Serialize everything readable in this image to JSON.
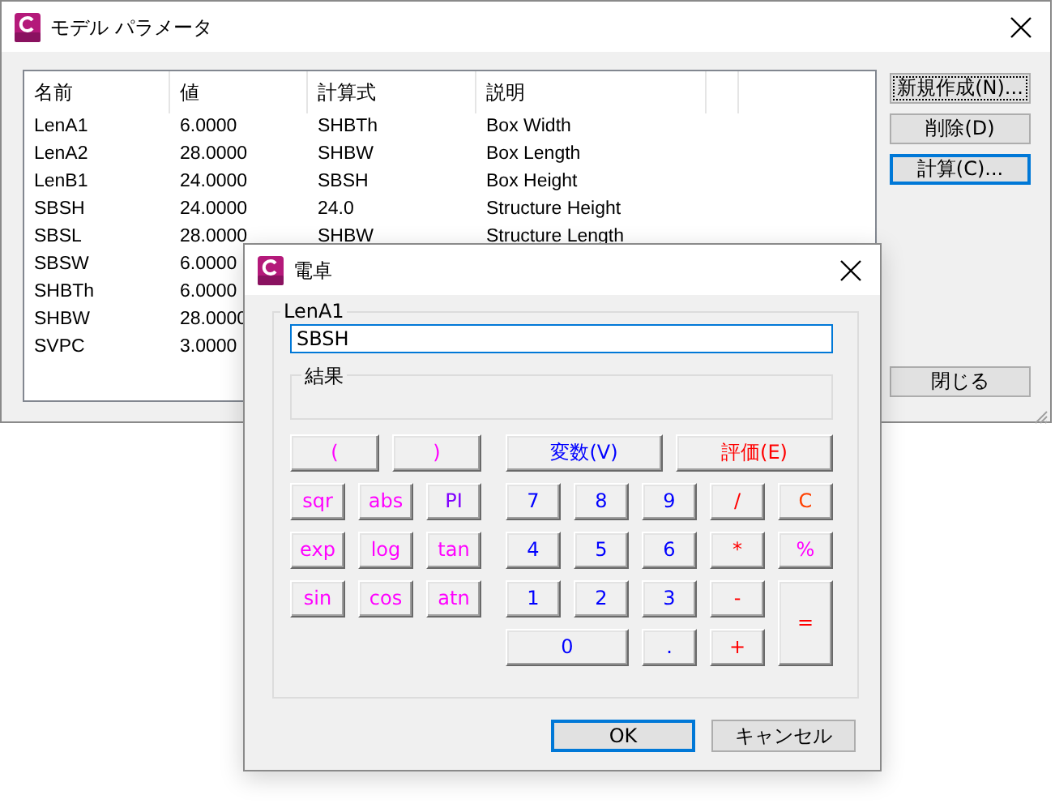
{
  "main_window": {
    "title": "モデル パラメータ",
    "table": {
      "columns": [
        "名前",
        "値",
        "計算式",
        "説明"
      ],
      "rows": [
        {
          "name": "LenA1",
          "value": "6.0000",
          "formula": "SHBTh",
          "description": "Box Width"
        },
        {
          "name": "LenA2",
          "value": "28.0000",
          "formula": "SHBW",
          "description": "Box Length"
        },
        {
          "name": "LenB1",
          "value": "24.0000",
          "formula": "SBSH",
          "description": "Box Height"
        },
        {
          "name": "SBSH",
          "value": "24.0000",
          "formula": "24.0",
          "description": "Structure Height"
        },
        {
          "name": "SBSL",
          "value": "28.0000",
          "formula": "SHBW",
          "description": "Structure Length"
        },
        {
          "name": "SBSW",
          "value": "6.0000"
        },
        {
          "name": "SHBTh",
          "value": "6.0000"
        },
        {
          "name": "SHBW",
          "value": "28.0000"
        },
        {
          "name": "SVPC",
          "value": "3.0000"
        }
      ]
    },
    "buttons": [
      {
        "label": "新規作成(N)...",
        "focused": true,
        "default": false
      },
      {
        "label": "削除(D)",
        "focused": false,
        "default": false
      },
      {
        "label": "計算(C)...",
        "focused": false,
        "default": true
      }
    ],
    "close_button": "閉じる"
  },
  "calculator": {
    "title": "電卓",
    "group_label": "LenA1",
    "expression": "SBSH",
    "result_label": "結果",
    "top_left_keys": [
      {
        "label": "(",
        "color": "#ff00ff"
      },
      {
        "label": ")",
        "color": "#ff00ff"
      }
    ],
    "top_right_keys": [
      {
        "label": "変数(V)",
        "color": "#0000ff"
      },
      {
        "label": "評価(E)",
        "color": "#ff0000"
      }
    ],
    "function_keys": [
      {
        "label": "sqr",
        "color": "#ff00ff"
      },
      {
        "label": "abs",
        "color": "#ff00ff"
      },
      {
        "label": "PI",
        "color": "#8000ff"
      },
      {
        "label": "exp",
        "color": "#ff00ff"
      },
      {
        "label": "log",
        "color": "#ff00ff"
      },
      {
        "label": "tan",
        "color": "#ff00ff"
      },
      {
        "label": "sin",
        "color": "#ff00ff"
      },
      {
        "label": "cos",
        "color": "#ff00ff"
      },
      {
        "label": "atn",
        "color": "#ff00ff"
      }
    ],
    "number_keys": [
      {
        "label": "7",
        "color": "#0000ff",
        "kind": "key"
      },
      {
        "label": "8",
        "color": "#0000ff",
        "kind": "key"
      },
      {
        "label": "9",
        "color": "#0000ff",
        "kind": "key"
      },
      {
        "label": "/",
        "color": "#ff0000",
        "kind": "key"
      },
      {
        "label": "C",
        "color": "#ff4000",
        "kind": "key"
      },
      {
        "label": "4",
        "color": "#0000ff",
        "kind": "key"
      },
      {
        "label": "5",
        "color": "#0000ff",
        "kind": "key"
      },
      {
        "label": "6",
        "color": "#0000ff",
        "kind": "key"
      },
      {
        "label": "*",
        "color": "#ff0000",
        "kind": "key"
      },
      {
        "label": "%",
        "color": "#ff00ff",
        "kind": "key"
      },
      {
        "label": "1",
        "color": "#0000ff",
        "kind": "key"
      },
      {
        "label": "2",
        "color": "#0000ff",
        "kind": "key"
      },
      {
        "label": "3",
        "color": "#0000ff",
        "kind": "key"
      },
      {
        "label": "-",
        "color": "#ff0000",
        "kind": "key"
      },
      {
        "label": "=",
        "color": "#ff0000",
        "kind": "tall"
      },
      {
        "label": "0",
        "color": "#0000ff",
        "kind": "wide"
      },
      {
        "label": ".",
        "color": "#0000ff",
        "kind": "key"
      },
      {
        "label": "+",
        "color": "#ff0000",
        "kind": "key"
      }
    ],
    "buttons": [
      {
        "label": "OK",
        "default": true
      },
      {
        "label": "キャンセル",
        "default": false
      }
    ]
  }
}
